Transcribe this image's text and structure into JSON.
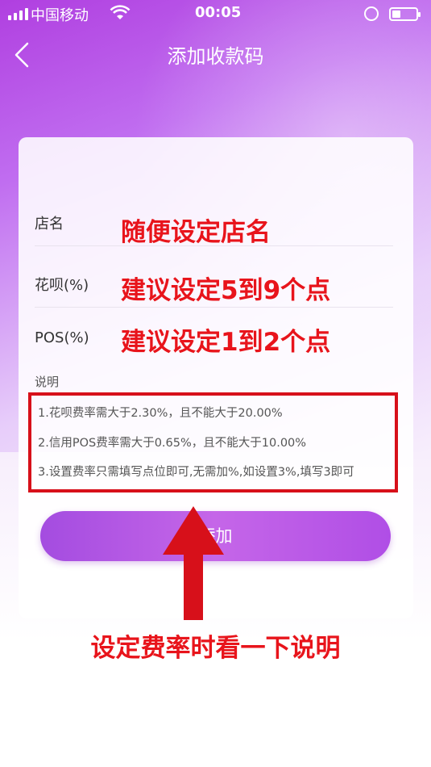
{
  "status_bar": {
    "carrier": "中国移动",
    "time": "00:05",
    "battery_level": 0.35
  },
  "nav": {
    "title": "添加收款码"
  },
  "form": {
    "store_name_label": "店名",
    "huabei_label": "花呗(%)",
    "pos_label": "POS(%)"
  },
  "annotations": {
    "store_name": "随便设定店名",
    "huabei": "建议设定5到9个点",
    "pos": "建议设定1到2个点",
    "bottom": "设定费率时看一下说明"
  },
  "notes": {
    "title": "说明",
    "items": [
      "1.花呗费率需大于2.30%，且不能大于20.00%",
      "2.信用POS费率需大于0.65%，且不能大于10.00%",
      "3.设置费率只需填写点位即可,无需加%,如设置3%,填写3即可"
    ]
  },
  "add_button": {
    "label": "添加"
  },
  "colors": {
    "annotation_red": "#e8141b",
    "accent_purple": "#b04ee6"
  }
}
